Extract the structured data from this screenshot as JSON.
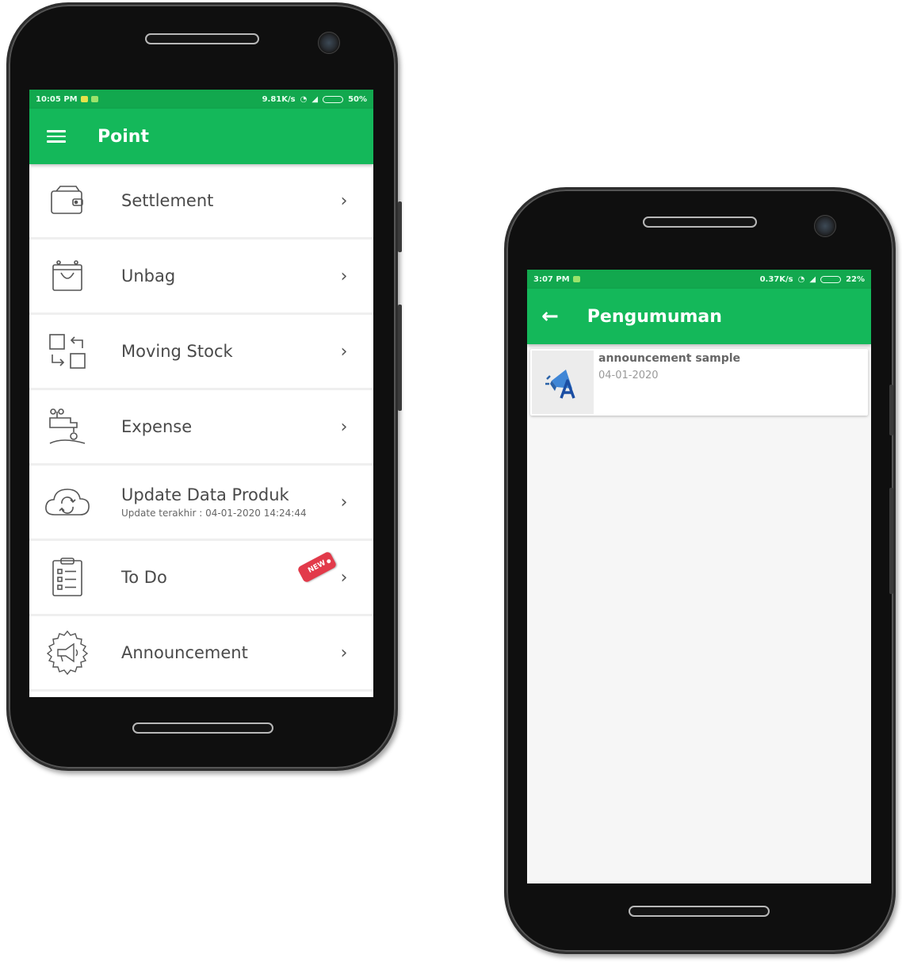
{
  "phone_left": {
    "status_bar": {
      "time": "10:05 PM",
      "network_speed": "9.81K/s",
      "battery": "50%"
    },
    "toolbar": {
      "menu_icon": "hamburger-menu-icon",
      "title": "Point"
    },
    "menu": [
      {
        "label": "Settlement",
        "sublabel": "",
        "icon": "wallet-icon"
      },
      {
        "label": "Unbag",
        "sublabel": "",
        "icon": "bag-icon"
      },
      {
        "label": "Moving Stock",
        "sublabel": "",
        "icon": "swap-boxes-icon"
      },
      {
        "label": "Expense",
        "sublabel": "",
        "icon": "tap-money-icon"
      },
      {
        "label": "Update Data Produk",
        "sublabel": "Update terakhir : 04-01-2020 14:24:44",
        "icon": "cloud-sync-icon"
      },
      {
        "label": "To Do",
        "sublabel": "",
        "icon": "clipboard-checklist-icon",
        "badge": "NEW"
      },
      {
        "label": "Announcement",
        "sublabel": "",
        "icon": "megaphone-badge-icon"
      }
    ],
    "chevron": "›"
  },
  "phone_right": {
    "status_bar": {
      "time": "3:07 PM",
      "network_speed": "0.37K/s",
      "battery": "22%"
    },
    "toolbar": {
      "back_icon": "back-arrow-icon",
      "back_glyph": "←",
      "title": "Pengumuman"
    },
    "announcements": [
      {
        "title": "announcement sample",
        "date": "04-01-2020",
        "icon": "megaphone-a-icon"
      }
    ]
  },
  "colors": {
    "statusbar": "#12a84e",
    "toolbar": "#14b85a",
    "badge": "#e23a4a"
  }
}
